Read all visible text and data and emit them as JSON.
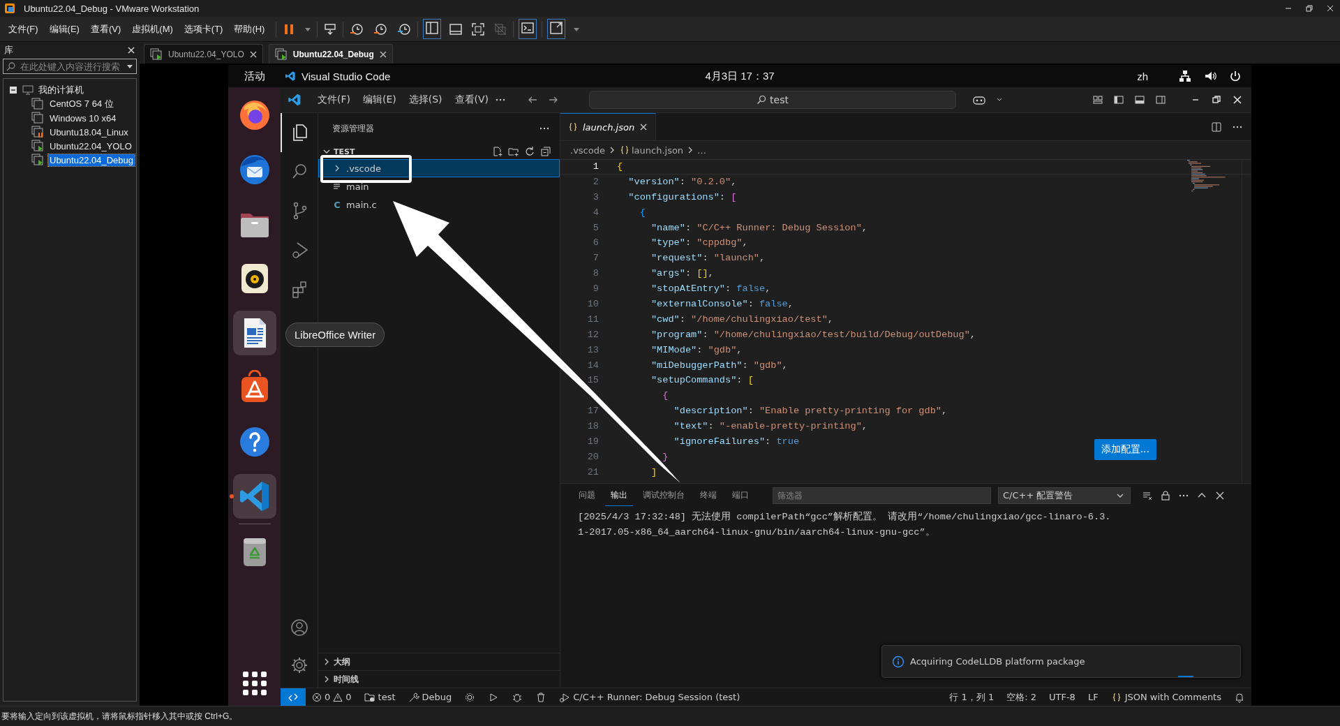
{
  "vmware": {
    "title": "Ubuntu22.04_Debug - VMware Workstation",
    "menu": [
      "文件(F)",
      "编辑(E)",
      "查看(V)",
      "虚拟机(M)",
      "选项卡(T)",
      "帮助(H)"
    ],
    "library": {
      "title": "库",
      "search": {
        "placeholder": "在此处键入内容进行搜索"
      },
      "tree": [
        {
          "label": "我的计算机",
          "expanded": true,
          "children": [
            {
              "label": "CentOS 7 64 位",
              "running": false,
              "paused": false,
              "selected": false
            },
            {
              "label": "Windows 10 x64",
              "running": false,
              "paused": false,
              "selected": false
            },
            {
              "label": "Ubuntu18.04_Linux",
              "running": false,
              "paused": true,
              "selected": false
            },
            {
              "label": "Ubuntu22.04_YOLO",
              "running": true,
              "paused": false,
              "selected": false
            },
            {
              "label": "Ubuntu22.04_Debug",
              "running": true,
              "paused": false,
              "selected": true
            }
          ]
        }
      ]
    },
    "tabs": [
      {
        "label": "Ubuntu22.04_YOLO",
        "selected": false
      },
      {
        "label": "Ubuntu22.04_Debug",
        "selected": true
      }
    ],
    "status_bar": "要将输入定向到该虚拟机，请将鼠标指针移入其中或按 Ctrl+G。"
  },
  "ubuntu": {
    "activities": "活动",
    "app_name": "Visual Studio Code",
    "clock": "4月3日 17：37",
    "input_method": "zh",
    "dock": [
      {
        "kind": "firefox",
        "running": false,
        "hovered": false
      },
      {
        "kind": "thunderbird",
        "running": false,
        "hovered": false
      },
      {
        "kind": "files",
        "running": false,
        "hovered": false
      },
      {
        "kind": "rhythmbox",
        "running": false,
        "hovered": false
      },
      {
        "kind": "writer",
        "running": false,
        "hovered": true
      },
      {
        "kind": "appcenter",
        "running": false,
        "hovered": false
      },
      {
        "kind": "help",
        "running": false,
        "hovered": false
      },
      {
        "kind": "vscode",
        "running": true,
        "hovered": false
      },
      {
        "kind": "trash",
        "running": false,
        "hovered": false
      }
    ],
    "tooltip": "LibreOffice Writer"
  },
  "vscode": {
    "menu": [
      "文件(F)",
      "编辑(E)",
      "选择(S)",
      "查看(V)"
    ],
    "command_center": "test",
    "activity_bar": [
      {
        "kind": "explorer",
        "selected": true
      },
      {
        "kind": "search",
        "selected": false
      },
      {
        "kind": "scm",
        "selected": false
      },
      {
        "kind": "debug",
        "selected": false
      },
      {
        "kind": "extensions",
        "selected": false
      }
    ],
    "sidebar": {
      "title": "资源管理器",
      "section": {
        "label": "TEST",
        "expanded": true,
        "items": [
          {
            "label": ".vscode",
            "kind": "folder",
            "expanded": false,
            "selected": true
          },
          {
            "label": "main",
            "kind": "file",
            "selected": false
          },
          {
            "label": "main.c",
            "kind": "file",
            "icon": "C",
            "selected": false
          }
        ]
      },
      "bottom_sections": [
        {
          "label": "大纲",
          "expanded": false
        },
        {
          "label": "时间线",
          "expanded": false
        }
      ]
    },
    "editor": {
      "tabs": [
        {
          "label": "launch.json",
          "selected": true,
          "preview": true
        }
      ],
      "breadcrumb": [
        ".vscode",
        "launch.json",
        "…"
      ],
      "lines": [
        {
          "n": "1",
          "current": true,
          "tokens": [
            {
              "text": "{",
              "kind": "gold"
            }
          ]
        },
        {
          "n": "2",
          "current": false,
          "tokens": [
            {
              "text": "  \"version\"",
              "kind": "key"
            },
            {
              "text": ": ",
              "kind": "punct"
            },
            {
              "text": "\"0.2.0\"",
              "kind": "string"
            },
            {
              "text": ",",
              "kind": "punct"
            }
          ]
        },
        {
          "n": "3",
          "current": false,
          "tokens": [
            {
              "text": "  \"configurations\"",
              "kind": "key"
            },
            {
              "text": ": ",
              "kind": "punct"
            },
            {
              "text": "[",
              "kind": "magenta"
            }
          ]
        },
        {
          "n": "4",
          "current": false,
          "tokens": [
            {
              "text": "    {",
              "kind": "blue"
            }
          ]
        },
        {
          "n": "5",
          "current": false,
          "tokens": [
            {
              "text": "      \"name\"",
              "kind": "key"
            },
            {
              "text": ": ",
              "kind": "punct"
            },
            {
              "text": "\"C/C++ Runner: Debug Session\"",
              "kind": "string"
            },
            {
              "text": ",",
              "kind": "punct"
            }
          ]
        },
        {
          "n": "6",
          "current": false,
          "tokens": [
            {
              "text": "      \"type\"",
              "kind": "key"
            },
            {
              "text": ": ",
              "kind": "punct"
            },
            {
              "text": "\"cppdbg\"",
              "kind": "string"
            },
            {
              "text": ",",
              "kind": "punct"
            }
          ]
        },
        {
          "n": "7",
          "current": false,
          "tokens": [
            {
              "text": "      \"request\"",
              "kind": "key"
            },
            {
              "text": ": ",
              "kind": "punct"
            },
            {
              "text": "\"launch\"",
              "kind": "string"
            },
            {
              "text": ",",
              "kind": "punct"
            }
          ]
        },
        {
          "n": "8",
          "current": false,
          "tokens": [
            {
              "text": "      \"args\"",
              "kind": "key"
            },
            {
              "text": ": ",
              "kind": "punct"
            },
            {
              "text": "[]",
              "kind": "gold"
            },
            {
              "text": ",",
              "kind": "punct"
            }
          ]
        },
        {
          "n": "9",
          "current": false,
          "tokens": [
            {
              "text": "      \"stopAtEntry\"",
              "kind": "key"
            },
            {
              "text": ": ",
              "kind": "punct"
            },
            {
              "text": "false",
              "kind": "literal"
            },
            {
              "text": ",",
              "kind": "punct"
            }
          ]
        },
        {
          "n": "10",
          "current": false,
          "tokens": [
            {
              "text": "      \"externalConsole\"",
              "kind": "key"
            },
            {
              "text": ": ",
              "kind": "punct"
            },
            {
              "text": "false",
              "kind": "literal"
            },
            {
              "text": ",",
              "kind": "punct"
            }
          ]
        },
        {
          "n": "11",
          "current": false,
          "tokens": [
            {
              "text": "      \"cwd\"",
              "kind": "key"
            },
            {
              "text": ": ",
              "kind": "punct"
            },
            {
              "text": "\"/home/chulingxiao/test\"",
              "kind": "string"
            },
            {
              "text": ",",
              "kind": "punct"
            }
          ]
        },
        {
          "n": "12",
          "current": false,
          "tokens": [
            {
              "text": "      \"program\"",
              "kind": "key"
            },
            {
              "text": ": ",
              "kind": "punct"
            },
            {
              "text": "\"/home/chulingxiao/test/build/Debug/outDebug\"",
              "kind": "string"
            },
            {
              "text": ",",
              "kind": "punct"
            }
          ]
        },
        {
          "n": "13",
          "current": false,
          "tokens": [
            {
              "text": "      \"MIMode\"",
              "kind": "key"
            },
            {
              "text": ": ",
              "kind": "punct"
            },
            {
              "text": "\"gdb\"",
              "kind": "string"
            },
            {
              "text": ",",
              "kind": "punct"
            }
          ]
        },
        {
          "n": "14",
          "current": false,
          "tokens": [
            {
              "text": "      \"miDebuggerPath\"",
              "kind": "key"
            },
            {
              "text": ": ",
              "kind": "punct"
            },
            {
              "text": "\"gdb\"",
              "kind": "string"
            },
            {
              "text": ",",
              "kind": "punct"
            }
          ]
        },
        {
          "n": "15",
          "current": false,
          "tokens": [
            {
              "text": "      \"setupCommands\"",
              "kind": "key"
            },
            {
              "text": ": ",
              "kind": "punct"
            },
            {
              "text": "[",
              "kind": "gold"
            }
          ]
        },
        {
          "current": false,
          "tokens": [
            {
              "text": "        {",
              "kind": "magenta"
            }
          ]
        },
        {
          "n": "17",
          "current": false,
          "tokens": [
            {
              "text": "          \"description\"",
              "kind": "key"
            },
            {
              "text": ": ",
              "kind": "punct"
            },
            {
              "text": "\"Enable pretty-printing for gdb\"",
              "kind": "string"
            },
            {
              "text": ",",
              "kind": "punct"
            }
          ]
        },
        {
          "n": "18",
          "current": false,
          "tokens": [
            {
              "text": "          \"text\"",
              "kind": "key"
            },
            {
              "text": ": ",
              "kind": "punct"
            },
            {
              "text": "\"-enable-pretty-printing\"",
              "kind": "string"
            },
            {
              "text": ",",
              "kind": "punct"
            }
          ]
        },
        {
          "n": "19",
          "current": false,
          "tokens": [
            {
              "text": "          \"ignoreFailures\"",
              "kind": "key"
            },
            {
              "text": ": ",
              "kind": "punct"
            },
            {
              "text": "true",
              "kind": "literal"
            }
          ]
        },
        {
          "n": "20",
          "current": false,
          "tokens": [
            {
              "text": "        }",
              "kind": "magenta"
            }
          ]
        },
        {
          "n": "21",
          "current": false,
          "tokens": [
            {
              "text": "      ]",
              "kind": "gold"
            }
          ]
        }
      ],
      "add_config_button": "添加配置..."
    },
    "panel": {
      "tabs": [
        {
          "label": "问题",
          "selected": false
        },
        {
          "label": "输出",
          "selected": true
        },
        {
          "label": "调试控制台",
          "selected": false
        },
        {
          "label": "终端",
          "selected": false
        },
        {
          "label": "端口",
          "selected": false
        }
      ],
      "filter": {
        "placeholder": "筛选器"
      },
      "channel": "C/C++ 配置警告",
      "output": [
        "[2025/4/3 17:32:48] 无法使用 compilerPath“gcc”解析配置。 请改用“/home/chulingxiao/gcc-linaro-6.3.",
        "1-2017.05-x86_64_aarch64-linux-gnu/bin/aarch64-linux-gnu-gcc”。"
      ]
    },
    "notification": {
      "message": "Acquiring CodeLLDB platform package"
    },
    "status_bar": {
      "errors": "0",
      "warnings": "0",
      "folder": "test",
      "build_type": "Debug",
      "debug_session": "C/C++ Runner: Debug Session (test)",
      "cursor": "行 1，列 1",
      "indent": "空格: 2",
      "encoding": "UTF-8",
      "eol": "LF",
      "language": "JSON with Comments"
    }
  }
}
